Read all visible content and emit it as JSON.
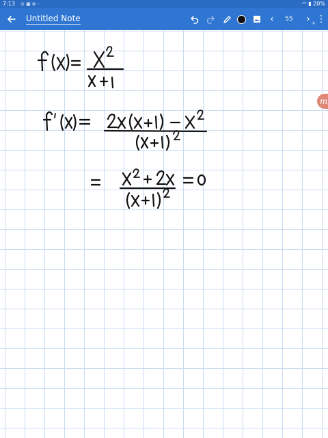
{
  "status_bar": {
    "time": "7:13",
    "battery": "20%"
  },
  "toolbar": {
    "title": "Untitled Note",
    "page_number": "55",
    "icons": [
      "back-arrow-icon",
      "undo-icon",
      "redo-icon",
      "pen-icon",
      "image-icon",
      "chevron-left-icon",
      "page-add-icon",
      "more-vertical-icon"
    ],
    "pen_color": "#111111"
  },
  "colors": {
    "status_bar": "#2a6cc4",
    "toolbar": "#2f76d2",
    "grid": "#c9dbf2",
    "handle": "#e08878"
  },
  "handwriting": {
    "line1": "f(x) = x^2 / (x + 1)",
    "line2": "f'(x) = (2x(x+1) - x^2) / (x+1)^2",
    "line3": "= (x^2 + 2x) / (x+1)^2 = 0"
  },
  "side_handle_icon": "m-logo-icon"
}
